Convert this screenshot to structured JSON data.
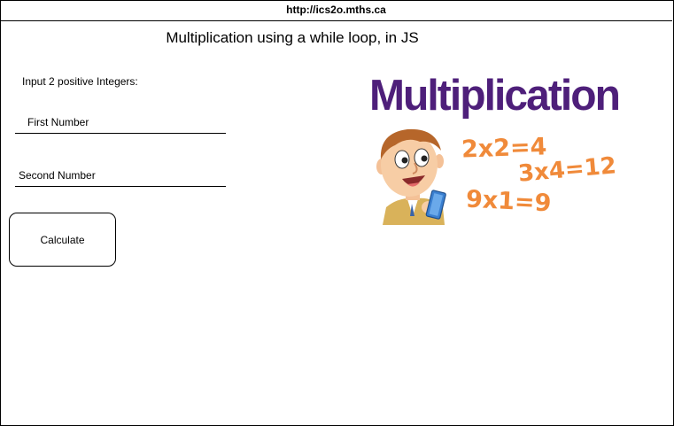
{
  "browser": {
    "url": "http://ics2o.mths.ca"
  },
  "page": {
    "title": "Multiplication using a while loop, in JS",
    "instruction": "Input 2 positive Integers:"
  },
  "form": {
    "first_number": {
      "value": "",
      "placeholder": "First Number"
    },
    "second_number": {
      "value": "",
      "placeholder": "Second Number"
    },
    "calculate_label": "Calculate"
  },
  "promo_image": {
    "heading": "Multiplication",
    "equations": [
      "2x2=4",
      "3x4=12",
      "9x1=9"
    ],
    "colors": {
      "heading": "#4e1f7a",
      "equations": "#f08a3a"
    },
    "icon": "cartoon-boy-with-tablet"
  }
}
